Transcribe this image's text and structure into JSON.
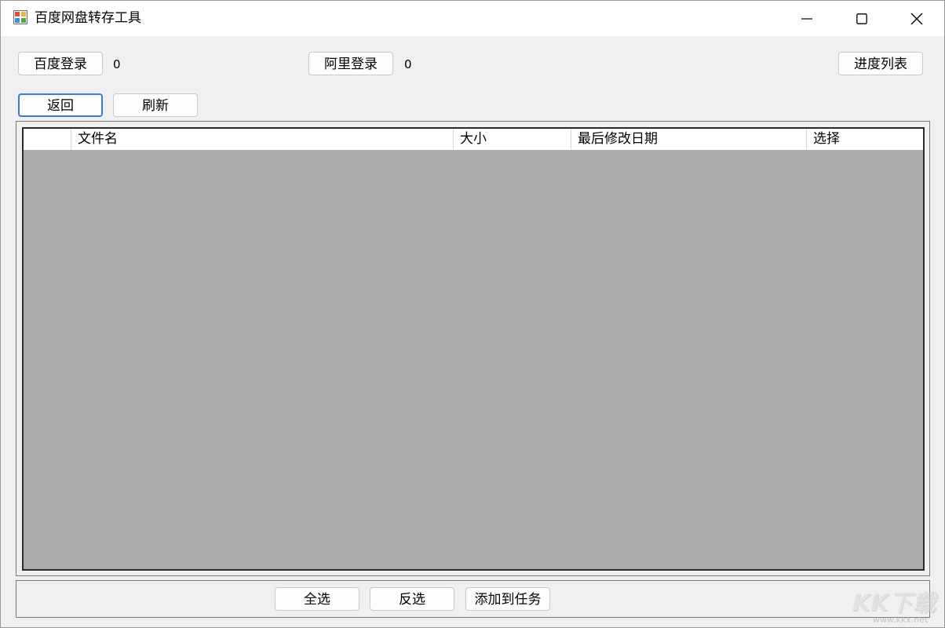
{
  "window": {
    "title": "百度网盘转存工具",
    "minimize_symbol": "—",
    "close_symbol": "✕"
  },
  "toolbar": {
    "baidu_login": "百度登录",
    "baidu_count": "0",
    "ali_login": "阿里登录",
    "ali_count": "0",
    "progress_list": "进度列表",
    "back": "返回",
    "refresh": "刷新"
  },
  "grid": {
    "columns": [
      "",
      "文件名",
      "大小",
      "最后修改日期",
      "选择"
    ],
    "rows": []
  },
  "bottom": {
    "select_all": "全选",
    "invert_selection": "反选",
    "add_to_task": "添加到任务"
  },
  "watermark": {
    "brand": "KK下载",
    "url": "www.kkx.net"
  },
  "colors": {
    "grid_background": "#ababab",
    "focus_border": "#3a7ad3",
    "window_background": "#f0f0f0"
  },
  "icons": {
    "app": "app-window-icon",
    "minimize": "minimize-icon",
    "maximize": "maximize-icon",
    "close": "close-icon"
  }
}
